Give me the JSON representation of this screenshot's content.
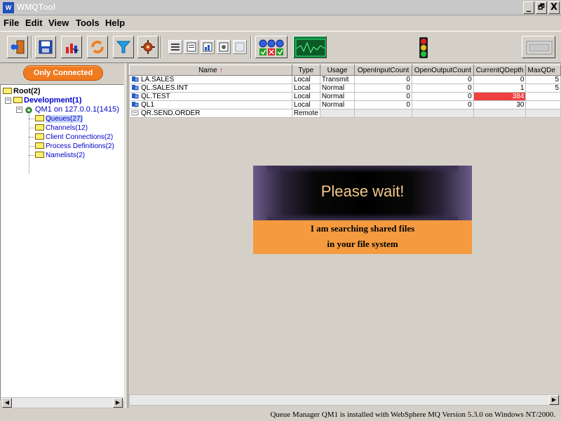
{
  "window": {
    "title": "WMQTool",
    "minimize": "_",
    "restore": "🗗",
    "close": "X"
  },
  "menu": [
    "File",
    "Edit",
    "View",
    "Tools",
    "Help"
  ],
  "toolbar": {
    "icons": [
      "exit-icon",
      "save-icon",
      "chart-icon",
      "refresh-icon",
      "filter-icon",
      "settings-icon",
      "view-list-icon",
      "view-detail-icon",
      "view-chart-icon",
      "view-props-icon",
      "view-blank-icon",
      "status-indicators-icon",
      "monitor-icon",
      "traffic-light-icon",
      "panel-icon"
    ]
  },
  "left": {
    "only_connected": "Only Connected",
    "tree": {
      "root": "Root(2)",
      "development": "Development(1)",
      "qm": "QM1  on 127.0.0.1(1415)",
      "queues": "Queues(27)",
      "channels": "Channels(12)",
      "client_connections": "Client Connections(2)",
      "process_definitions": "Process Definitions(2)",
      "namelists": "Namelists(2)"
    }
  },
  "table": {
    "headers": [
      "Name",
      "Type",
      "Usage",
      "OpenInputCount",
      "OpenOutputCount",
      "CurrentQDepth",
      "MaxQDe"
    ],
    "sort_indicator": "↑",
    "rows": [
      {
        "name": "LA.SALES",
        "type": "Local",
        "usage": "Transmit",
        "open_input": "0",
        "open_output": "0",
        "depth": "0",
        "max": "5"
      },
      {
        "name": "QL.SALES.INT",
        "type": "Local",
        "usage": "Normal",
        "open_input": "0",
        "open_output": "0",
        "depth": "1",
        "max": "5"
      },
      {
        "name": "QL.TEST",
        "type": "Local",
        "usage": "Normal",
        "open_input": "0",
        "open_output": "0",
        "depth": "384",
        "max": ""
      },
      {
        "name": "QL1",
        "type": "Local",
        "usage": "Normal",
        "open_input": "0",
        "open_output": "0",
        "depth": "30",
        "max": ""
      },
      {
        "name": "QR.SEND.ORDER",
        "type": "Remote",
        "usage": "",
        "open_input": "",
        "open_output": "",
        "depth": "",
        "max": ""
      }
    ]
  },
  "wait_dialog": {
    "title": "Please wait!",
    "line1": "I am searching shared files",
    "line2": "in your file system"
  },
  "status": {
    "text": "Queue Manager QM1  is installed with WebSphere MQ Version 5.3.0 on Windows NT/2000."
  },
  "colors": {
    "accent_orange": "#f07a20",
    "hot_cell": "#f04040",
    "wait_panel": "#f49a3f"
  }
}
